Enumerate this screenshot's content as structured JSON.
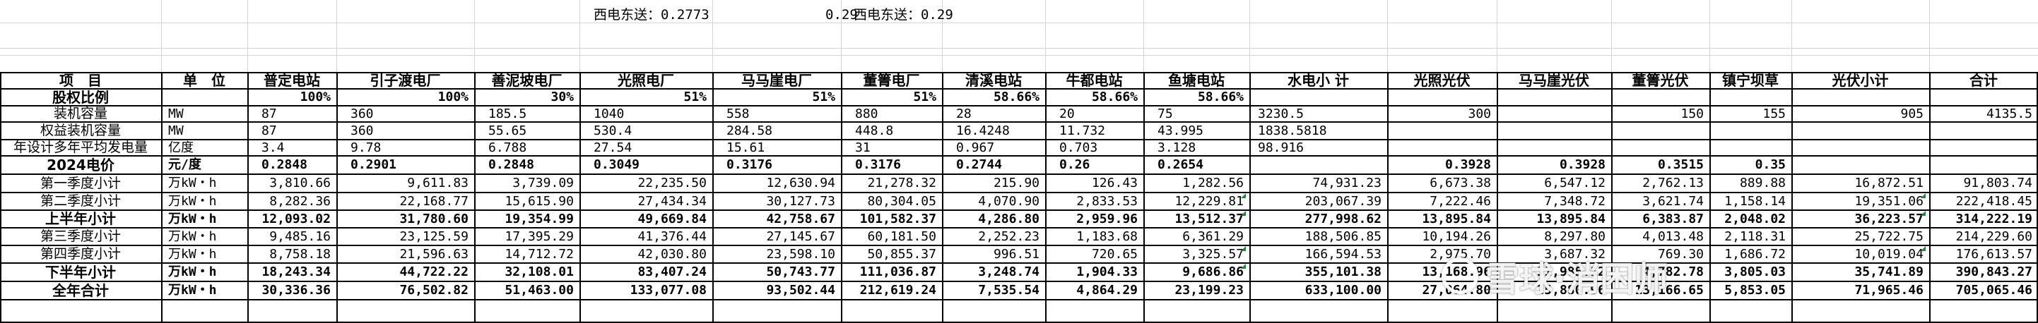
{
  "top_notes": [
    {
      "id": "west_east_1",
      "text": "西电东送：0.2773"
    },
    {
      "id": "value_029",
      "text": "0.29"
    },
    {
      "id": "west_east_2",
      "text": "西电东送：0.29"
    }
  ],
  "header_row": [
    "项　目",
    "单　位",
    "普定电站",
    "引子渡电厂",
    "善泥坡电厂",
    "光照电厂",
    "马马崖电厂",
    "董箐电厂",
    "清溪电站",
    "牛都电站",
    "鱼塘电站",
    "水电小 计",
    "光照光伏",
    "马马崖光伏",
    "董箐光伏",
    "镇宁坝草",
    "光伏小计",
    "合计"
  ],
  "rows": [
    {
      "name": "equity_ratio",
      "bold": true,
      "cells": [
        "股权比例",
        "",
        "100%",
        "100%",
        "30%",
        "51%",
        "51%",
        "51%",
        "58.66%",
        "58.66%",
        "58.66%",
        "",
        "",
        "",
        "",
        "",
        "",
        ""
      ]
    },
    {
      "name": "installed_capacity",
      "bold": false,
      "cells": [
        "装机容量",
        "MW",
        "87",
        "360",
        "185.5",
        "1040",
        "558",
        "880",
        "28",
        "20",
        "75",
        "3230.5",
        "300",
        "",
        "150",
        "155",
        "905",
        "4135.5"
      ]
    },
    {
      "name": "equity_capacity",
      "bold": false,
      "cells": [
        "权益装机容量",
        "MW",
        "87",
        "360",
        "55.65",
        "530.4",
        "284.58",
        "448.8",
        "16.4248",
        "11.732",
        "43.995",
        "1838.5818",
        "",
        "",
        "",
        "",
        "",
        ""
      ]
    },
    {
      "name": "avg_generation",
      "bold": false,
      "cells": [
        "年设计多年平均发电量",
        "亿度",
        "3.4",
        "9.78",
        "6.788",
        "27.54",
        "15.61",
        "31",
        "0.967",
        "0.703",
        "3.128",
        "98.916",
        "",
        "",
        "",
        "",
        "",
        ""
      ]
    },
    {
      "name": "price_2024",
      "bold": true,
      "cells": [
        "2024电价",
        "元/度",
        "0.2848",
        "0.2901",
        "0.2848",
        "0.3049",
        "0.3176",
        "0.3176",
        "0.2744",
        "0.26",
        "0.2654",
        "",
        "0.3928",
        "0.3928",
        "0.3515",
        "0.35",
        "",
        ""
      ]
    },
    {
      "name": "q1_subtotal",
      "bold": false,
      "cells": [
        "第一季度小计",
        "万kW・h",
        "3,810.66",
        "9,611.83",
        "3,739.09",
        "22,235.50",
        "12,630.94",
        "21,278.32",
        "215.90",
        "126.43",
        "1,282.56",
        "74,931.23",
        "6,673.38",
        "6,547.12",
        "2,762.13",
        "889.88",
        "16,872.51",
        "91,803.74"
      ]
    },
    {
      "name": "q2_subtotal",
      "bold": false,
      "cells": [
        "第二季度小计",
        "万kW・h",
        "8,282.36",
        "22,168.77",
        "15,615.90",
        "27,434.34",
        "30,127.73",
        "80,304.05",
        "4,070.90",
        "2,833.53",
        "12,229.81",
        "203,067.39",
        "7,222.46",
        "7,348.72",
        "3,621.74",
        "1,158.14",
        "19,351.06",
        "222,418.45"
      ]
    },
    {
      "name": "h1_subtotal",
      "bold": true,
      "cells": [
        "上半年小计",
        "万kW・h",
        "12,093.02",
        "31,780.60",
        "19,354.99",
        "49,669.84",
        "42,758.67",
        "101,582.37",
        "4,286.80",
        "2,959.96",
        "13,512.37",
        "277,998.62",
        "13,895.84",
        "13,895.84",
        "6,383.87",
        "2,048.02",
        "36,223.57",
        "314,222.19"
      ]
    },
    {
      "name": "q3_subtotal",
      "bold": false,
      "cells": [
        "第三季度小计",
        "万kW・h",
        "9,485.16",
        "23,125.59",
        "17,395.29",
        "41,376.44",
        "27,145.67",
        "60,181.50",
        "2,252.23",
        "1,183.68",
        "6,361.29",
        "188,506.85",
        "10,194.26",
        "8,297.80",
        "4,013.48",
        "2,118.31",
        "25,722.75",
        "214,229.60"
      ]
    },
    {
      "name": "q4_subtotal",
      "bold": false,
      "cells": [
        "第四季度小计",
        "万kW・h",
        "8,758.18",
        "21,596.63",
        "14,712.72",
        "42,030.80",
        "23,598.10",
        "50,855.37",
        "996.51",
        "720.65",
        "3,325.57",
        "166,594.53",
        "2,975.70",
        "3,687.32",
        "769.30",
        "1,686.72",
        "10,019.04",
        "176,613.57"
      ]
    },
    {
      "name": "h2_subtotal",
      "bold": true,
      "cells": [
        "下半年小计",
        "万kW・h",
        "18,243.34",
        "44,722.22",
        "32,108.01",
        "83,407.24",
        "50,743.77",
        "111,036.87",
        "3,248.74",
        "1,904.33",
        "9,686.86",
        "355,101.38",
        "13,168.96",
        "11,985.12",
        "4,782.78",
        "3,805.03",
        "35,741.89",
        "390,843.27"
      ]
    },
    {
      "name": "full_year_total",
      "bold": true,
      "cells": [
        "全年合计",
        "万kW・h",
        "30,336.36",
        "76,502.82",
        "51,463.00",
        "133,077.08",
        "93,502.44",
        "212,619.24",
        "7,535.54",
        "4,864.29",
        "23,199.23",
        "633,100.00",
        "27,064.80",
        "25,880.96",
        "13,166.65",
        "5,853.05",
        "71,965.46",
        "705,065.46"
      ]
    }
  ],
  "watermark": {
    "text": "雪球·消困师",
    "icon": "snowball-logo-icon"
  }
}
